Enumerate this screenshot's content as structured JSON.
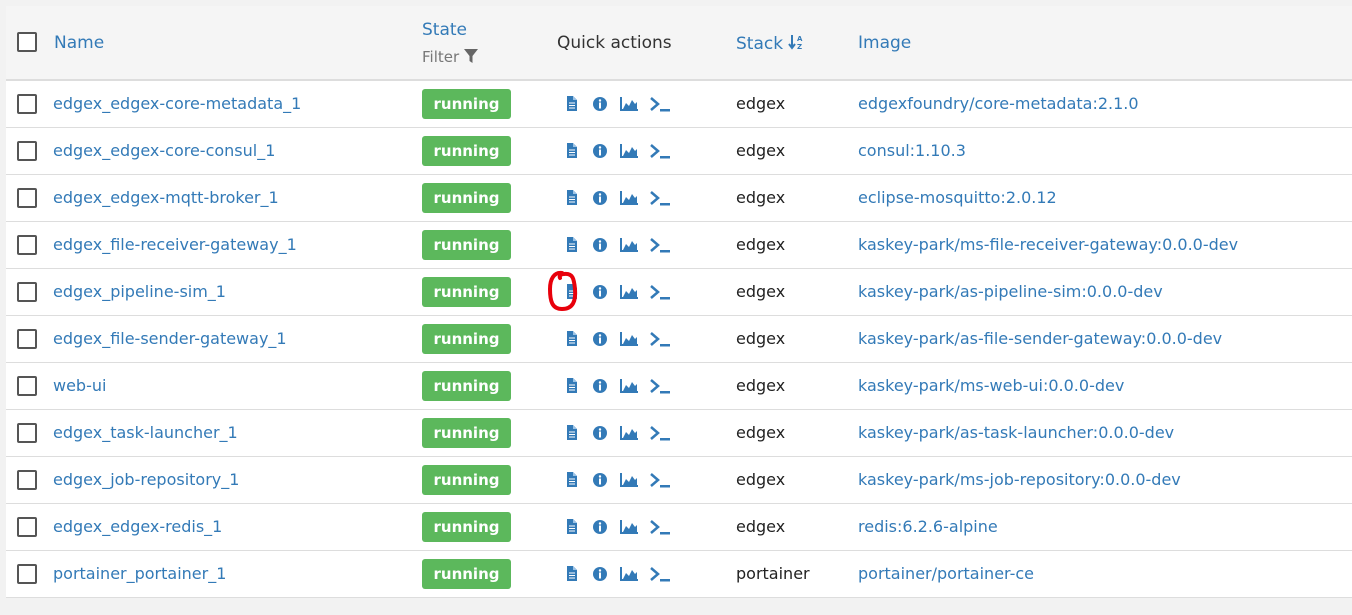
{
  "header": {
    "name_label": "Name",
    "state_label": "State",
    "filter_label": "Filter",
    "quick_actions_label": "Quick actions",
    "stack_label": "Stack",
    "sort_icon": "sort-alpha-down-icon",
    "image_label": "Image"
  },
  "colors": {
    "link": "#337ab7",
    "running": "#5cb85c",
    "annotation": "#e8000b"
  },
  "quick_action_icons": [
    "logs-icon",
    "info-icon",
    "stats-icon",
    "console-icon"
  ],
  "rows": [
    {
      "name": "edgex_edgex-core-metadata_1",
      "state": "running",
      "stack": "edgex",
      "image": "edgexfoundry/core-metadata:2.1.0"
    },
    {
      "name": "edgex_edgex-core-consul_1",
      "state": "running",
      "stack": "edgex",
      "image": "consul:1.10.3"
    },
    {
      "name": "edgex_edgex-mqtt-broker_1",
      "state": "running",
      "stack": "edgex",
      "image": "eclipse-mosquitto:2.0.12"
    },
    {
      "name": "edgex_file-receiver-gateway_1",
      "state": "running",
      "stack": "edgex",
      "image": "kaskey-park/ms-file-receiver-gateway:0.0.0-dev"
    },
    {
      "name": "edgex_pipeline-sim_1",
      "state": "running",
      "stack": "edgex",
      "image": "kaskey-park/as-pipeline-sim:0.0.0-dev"
    },
    {
      "name": "edgex_file-sender-gateway_1",
      "state": "running",
      "stack": "edgex",
      "image": "kaskey-park/as-file-sender-gateway:0.0.0-dev"
    },
    {
      "name": "web-ui",
      "state": "running",
      "stack": "edgex",
      "image": "kaskey-park/ms-web-ui:0.0.0-dev"
    },
    {
      "name": "edgex_task-launcher_1",
      "state": "running",
      "stack": "edgex",
      "image": "kaskey-park/as-task-launcher:0.0.0-dev"
    },
    {
      "name": "edgex_job-repository_1",
      "state": "running",
      "stack": "edgex",
      "image": "kaskey-park/ms-job-repository:0.0.0-dev"
    },
    {
      "name": "edgex_edgex-redis_1",
      "state": "running",
      "stack": "edgex",
      "image": "redis:6.2.6-alpine"
    },
    {
      "name": "portainer_portainer_1",
      "state": "running",
      "stack": "portainer",
      "image": "portainer/portainer-ce"
    }
  ]
}
